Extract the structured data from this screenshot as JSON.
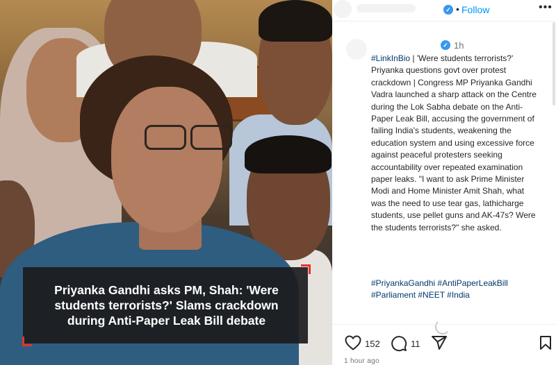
{
  "post": {
    "caption_overlay": "Priyanka Gandhi asks PM, Shah: 'Were students terrorists?' Slams crackdown during Anti-Paper Leak Bill debate"
  },
  "header": {
    "verified_icon": "check-badge-icon",
    "separator": "•",
    "follow_label": "Follow",
    "more_icon": "•••"
  },
  "comment": {
    "time": "1h",
    "text_tag": "#LinkInBio",
    "text_body": " | 'Were students terrorists?' Priyanka questions govt over protest crackdown | Congress MP Priyanka Gandhi Vadra launched a sharp attack on the Centre during the Lok Sabha debate on the Anti-Paper Leak Bill, accusing the government of failing India's students, weakening the education system and using excessive force against peaceful protesters seeking accountability over repeated examination paper leaks. \"I want to ask Prime Minister Modi and Home Minister Amit Shah, what was the need to use tear gas, lathicharge students, use pellet guns and AK-47s? Were the students terrorists?\" she asked.",
    "hashtags": "#PriyankaGandhi #AntiPaperLeakBill #Parliament #NEET #India"
  },
  "actions": {
    "likes": "152",
    "comments": "11",
    "icons": [
      "heart-icon",
      "comment-icon",
      "share-icon",
      "bookmark-icon"
    ]
  },
  "footer": {
    "time_ago": "1 hour ago"
  },
  "colors": {
    "accent_blue": "#0095f6",
    "hashtag": "#00376b",
    "caption_bg": "#1c1c1e",
    "caption_corner": "#e8322a"
  }
}
